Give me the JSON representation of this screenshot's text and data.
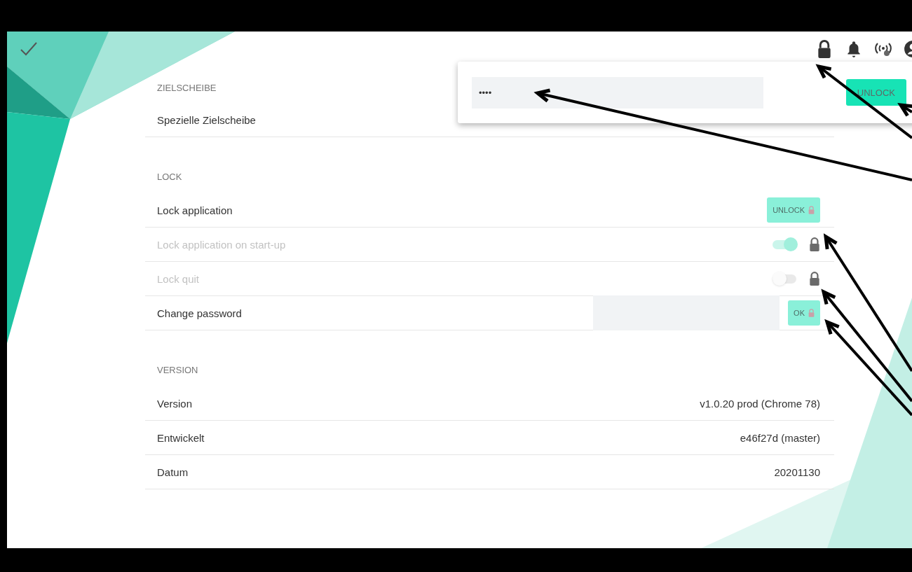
{
  "popover": {
    "password": "••••",
    "button": "UNLOCK"
  },
  "sections": [
    {
      "title": "ZIELSCHEIBE",
      "rows": [
        {
          "kind": "text",
          "label": "Spezielle Zielscheibe",
          "disabled": false
        }
      ]
    },
    {
      "title": "LOCK",
      "rows": [
        {
          "kind": "button",
          "label": "Lock application",
          "disabled": false,
          "button": "UNLOCK",
          "button_disabled": true
        },
        {
          "kind": "toggle",
          "label": "Lock application on start-up",
          "disabled": true,
          "on": true
        },
        {
          "kind": "toggle",
          "label": "Lock quit",
          "disabled": true,
          "on": false
        },
        {
          "kind": "password",
          "label": "Change password",
          "disabled": false,
          "button": "OK",
          "button_disabled": true
        }
      ]
    },
    {
      "title": "VERSION",
      "rows": [
        {
          "kind": "text",
          "label": "Version",
          "value": "v1.0.20 prod (Chrome 78)",
          "disabled": false
        },
        {
          "kind": "text",
          "label": "Entwickelt",
          "value": "e46f27d (master)",
          "disabled": false
        },
        {
          "kind": "text",
          "label": "Datum",
          "value": "20201130",
          "disabled": false
        }
      ]
    }
  ]
}
